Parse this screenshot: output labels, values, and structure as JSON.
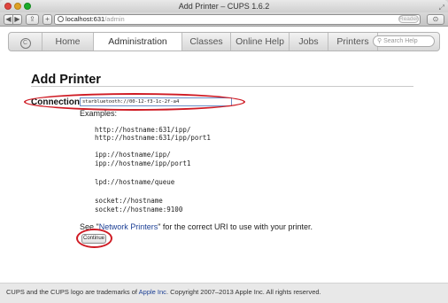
{
  "window": {
    "title": "Add Printer – CUPS 1.6.2"
  },
  "toolbar": {
    "back": "◀",
    "forward": "▶",
    "share": "⇪",
    "add": "+",
    "url_host": "localhost:631",
    "url_path": "/admin",
    "reload": "C",
    "reader": "Reader",
    "downloads": "⊙"
  },
  "nav": {
    "items": [
      "Home",
      "Administration",
      "Classes",
      "Online Help",
      "Jobs",
      "Printers"
    ],
    "active": "Administration",
    "search_placeholder": "Search Help"
  },
  "page": {
    "title": "Add Printer",
    "connection_label": "Connection:",
    "connection_value": "starbluetooth://00-12-f3-1c-2f-a4",
    "examples_label": "Examples:",
    "examples": [
      "http://hostname:631/ipp/",
      "http://hostname:631/ipp/port1",
      "ipp://hostname/ipp/",
      "ipp://hostname/ipp/port1",
      "lpd://hostname/queue",
      "socket://hostname",
      "socket://hostname:9100"
    ],
    "see_prefix": "See \"",
    "see_link": "Network Printers",
    "see_suffix": "\" for the correct URI to use with your printer.",
    "continue_label": "Continue"
  },
  "footer": {
    "prefix": "CUPS and the CUPS logo are trademarks of ",
    "link": "Apple Inc",
    "suffix": ". Copyright 2007–2013 Apple Inc. All rights reserved."
  },
  "colors": {
    "annotation": "#cf1b24",
    "link": "#1c3f95"
  }
}
